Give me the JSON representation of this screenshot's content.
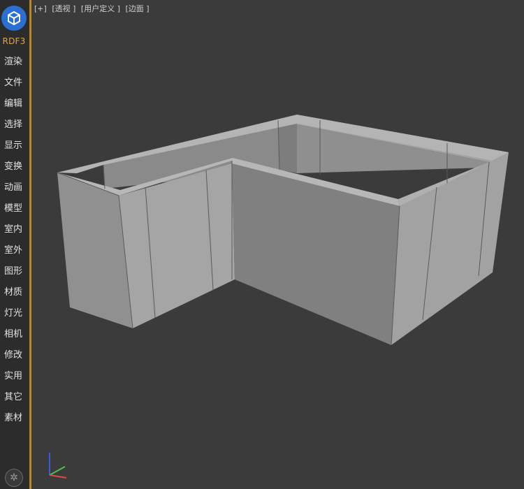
{
  "brand": {
    "label": "RDF3",
    "color": "#e0a64a"
  },
  "viewport": {
    "labels": [
      "[+]",
      "[透视 ]",
      "[用户定义 ]",
      "[边面 ]"
    ]
  },
  "sidebar": {
    "items": [
      {
        "label": "渲染"
      },
      {
        "label": "文件"
      },
      {
        "label": "编辑"
      },
      {
        "label": "选择"
      },
      {
        "label": "显示"
      },
      {
        "label": "变换"
      },
      {
        "label": "动画"
      },
      {
        "label": "模型"
      },
      {
        "label": "室内"
      },
      {
        "label": "室外"
      },
      {
        "label": "图形"
      },
      {
        "label": "材质"
      },
      {
        "label": "灯光"
      },
      {
        "label": "相机"
      },
      {
        "label": "修改"
      },
      {
        "label": "实用"
      },
      {
        "label": "其它"
      },
      {
        "label": "素材"
      }
    ]
  },
  "icons": {
    "logo": "cube-logo-icon",
    "settings": "gear-icon",
    "axis": "axis-gizmo-icon"
  },
  "colors": {
    "accent": "#b08a38",
    "logo_bg": "#2b6fd2",
    "viewport_bg": "#3b3b3b",
    "sidebar_bg": "#2c2c2c"
  }
}
